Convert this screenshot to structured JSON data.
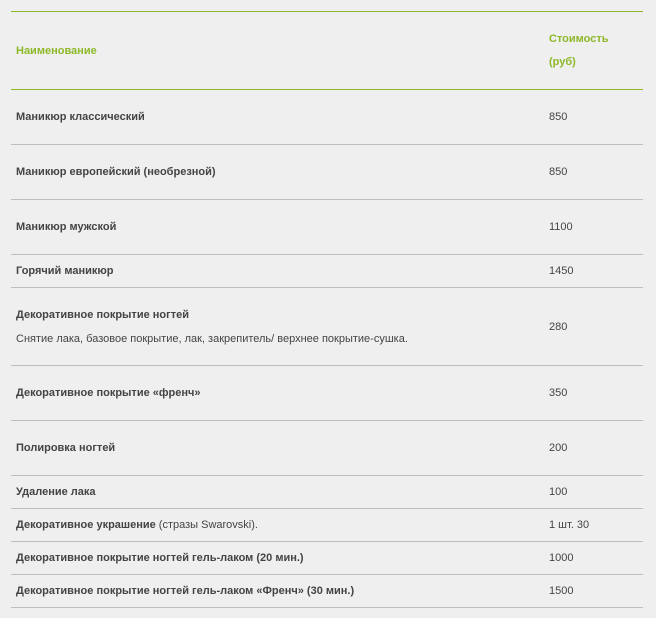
{
  "header": {
    "name_label": "Наименование",
    "price_label_line1": "Стоимость",
    "price_label_line2": "(руб)"
  },
  "rows": [
    {
      "name": "Маникюр классический",
      "price": "850"
    },
    {
      "name": "Маникюр европейский (необрезной)",
      "price": "850"
    },
    {
      "name": "Маникюр мужской",
      "price": "1100"
    },
    {
      "name": "Горячий маникюр",
      "price": "1450"
    },
    {
      "name": "Декоративное покрытие ногтей",
      "description": "Снятие лака, базовое покрытие, лак, закрепитель/ верхнее покрытие-сушка.",
      "price": "280"
    },
    {
      "name": "Декоративное покрытие «френч»",
      "price": "350"
    },
    {
      "name": "Полировка ногтей",
      "price": "200"
    },
    {
      "name": "Удаление лака",
      "price": "100"
    },
    {
      "name": "Декоративное украшение",
      "note": " (стразы Swarovski).",
      "price": "1 шт. 30"
    },
    {
      "name": "Декоративное покрытие ногтей гель-лаком (20 мин.)",
      "price": "1000"
    },
    {
      "name": "Декоративное покрытие ногтей гель-лаком «Френч» (30 мин.)",
      "price": "1500"
    }
  ],
  "colors": {
    "accent": "#8db82a",
    "text": "#444444",
    "background": "#efefef",
    "divider": "#bdbdbd"
  }
}
